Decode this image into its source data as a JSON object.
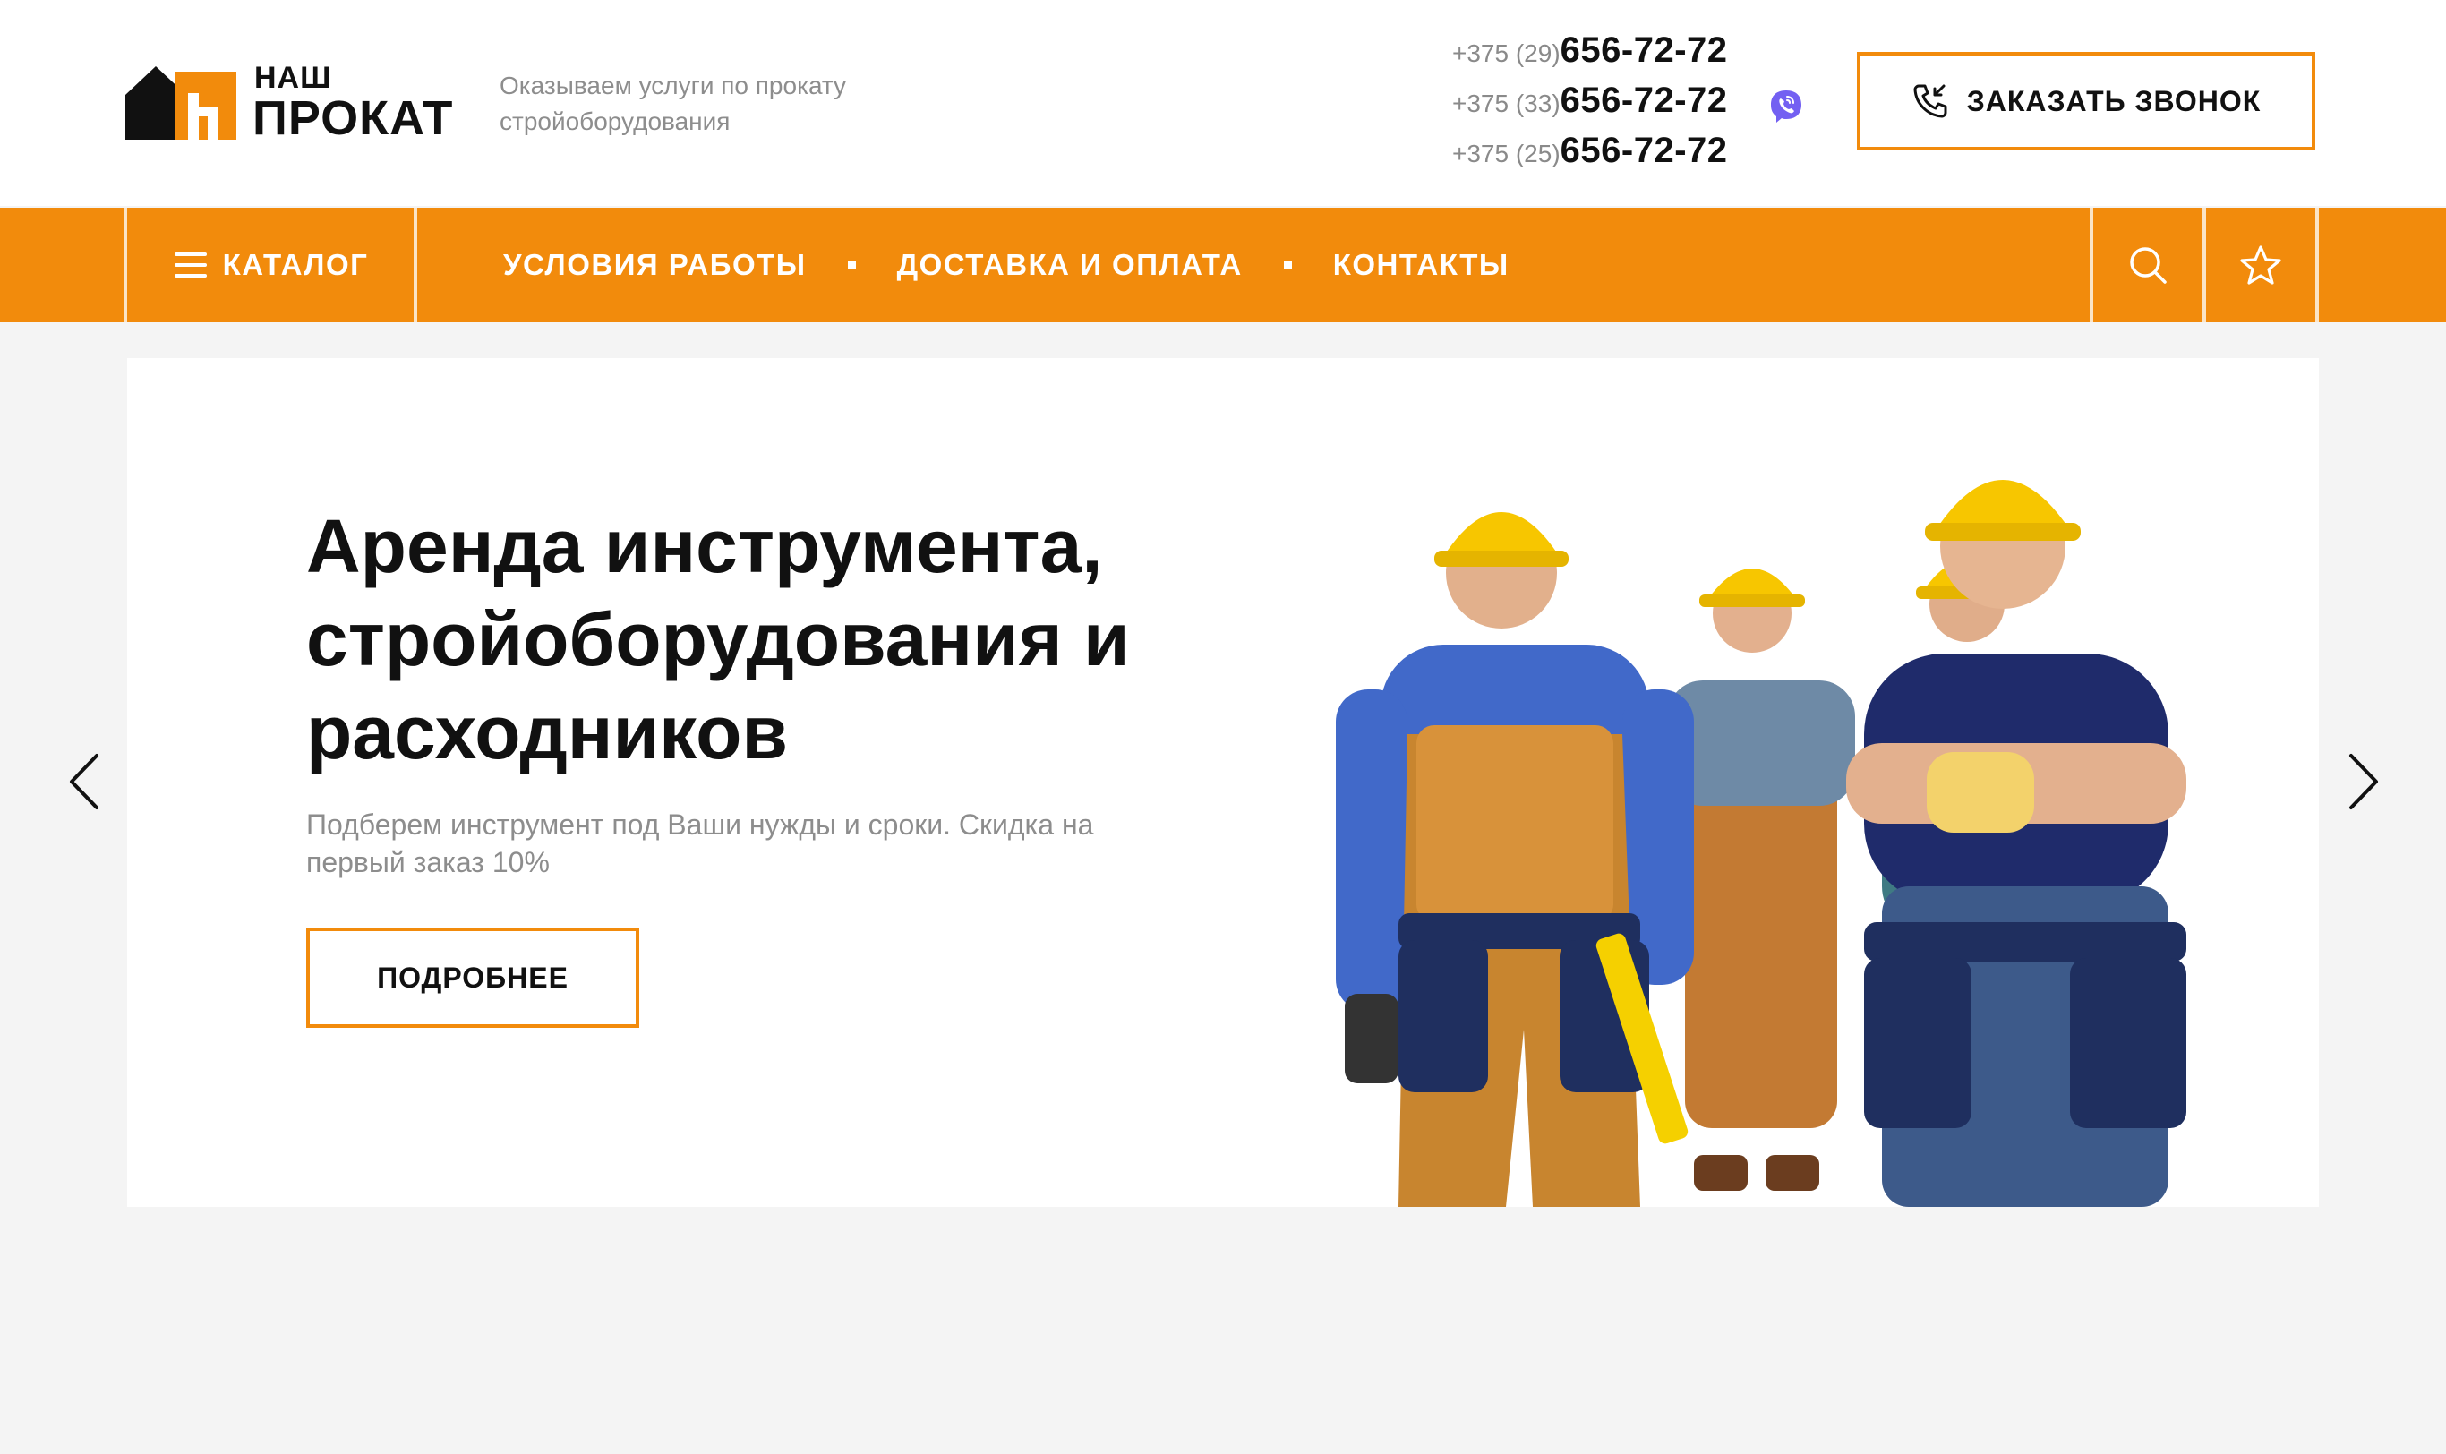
{
  "header": {
    "logo": {
      "line1": "НАШ",
      "line2": "ПРОКАТ"
    },
    "tagline": {
      "line1": "Оказываем услуги по прокату",
      "line2": "стройоборудования"
    },
    "phones": [
      {
        "code": "+375 (29)",
        "number": "656-72-72",
        "viber": false
      },
      {
        "code": "+375 (33)",
        "number": "656-72-72",
        "viber": true
      },
      {
        "code": "+375 (25)",
        "number": "656-72-72",
        "viber": false
      }
    ],
    "callback_button": "ЗАКАЗАТЬ ЗВОНОК"
  },
  "nav": {
    "catalog": "КАТАЛОГ",
    "items": [
      "УСЛОВИЯ РАБОТЫ",
      "ДОСТАВКА И ОПЛАТА",
      "КОНТАКТЫ"
    ],
    "icons": [
      "search-icon",
      "star-icon",
      "hamburger-icon"
    ]
  },
  "slider": {
    "title": {
      "line1": "Аренда инструмента,",
      "line2": "стройоборудования и",
      "line3": "расходников"
    },
    "subtitle": {
      "line1": "Подберем инструмент под Ваши нужды и сроки. Скидка на",
      "line2": "первый заказ 10%"
    },
    "button": "ПОДРОБНЕЕ",
    "arrows": [
      "chevron-left-icon",
      "chevron-right-icon"
    ]
  },
  "colors": {
    "accent": "#f28b0c",
    "text": "#111111",
    "muted": "#8d8d8d",
    "background": "#f4f4f4",
    "viber": "#7360f2"
  }
}
